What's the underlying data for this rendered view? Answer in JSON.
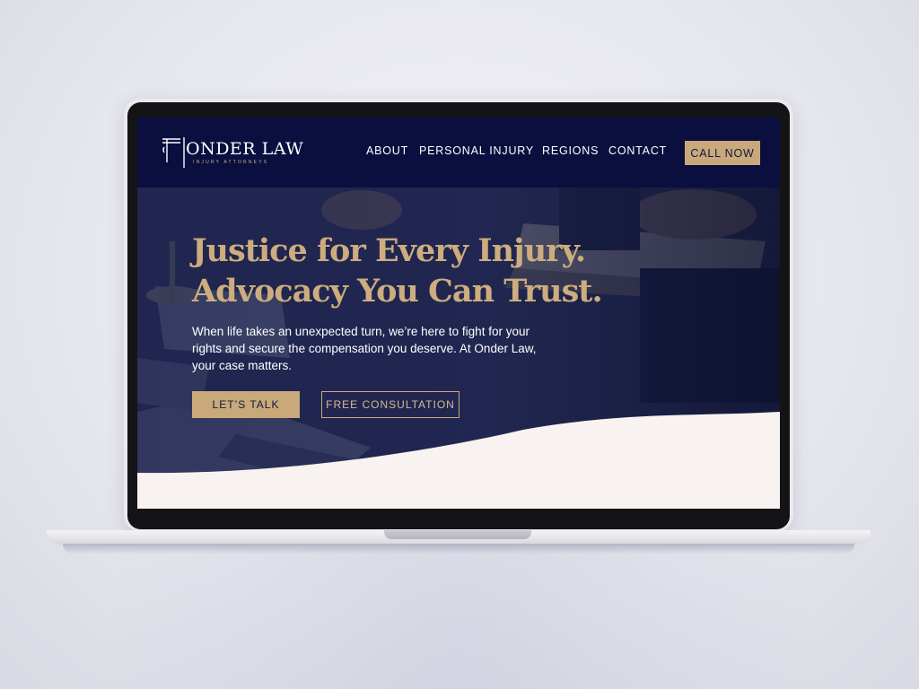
{
  "site": {
    "brand": {
      "name": "ONDER LAW",
      "tagline": "INJURY ATTORNEYS"
    },
    "nav": {
      "items": [
        {
          "label": "ABOUT"
        },
        {
          "label": "PERSONAL INJURY"
        },
        {
          "label": "REGIONS"
        },
        {
          "label": "CONTACT"
        }
      ],
      "cta_label": "CALL NOW"
    },
    "hero": {
      "headline_line1": "Justice for Every Injury.",
      "headline_line2": "Advocacy You Can Trust.",
      "subtext": "When life takes an unexpected turn, we’re here to fight for your rights and secure the compensation you deserve. At Onder Law, your case matters.",
      "primary_button": "LET’S TALK",
      "secondary_button": "FREE CONSULTATION"
    }
  },
  "colors": {
    "navy": "#0a0f3f",
    "gold": "#c9a97a",
    "cream": "#f8f3f0",
    "background": "#e6e6ee"
  },
  "icons": {
    "logo": "pillar-column-icon"
  }
}
